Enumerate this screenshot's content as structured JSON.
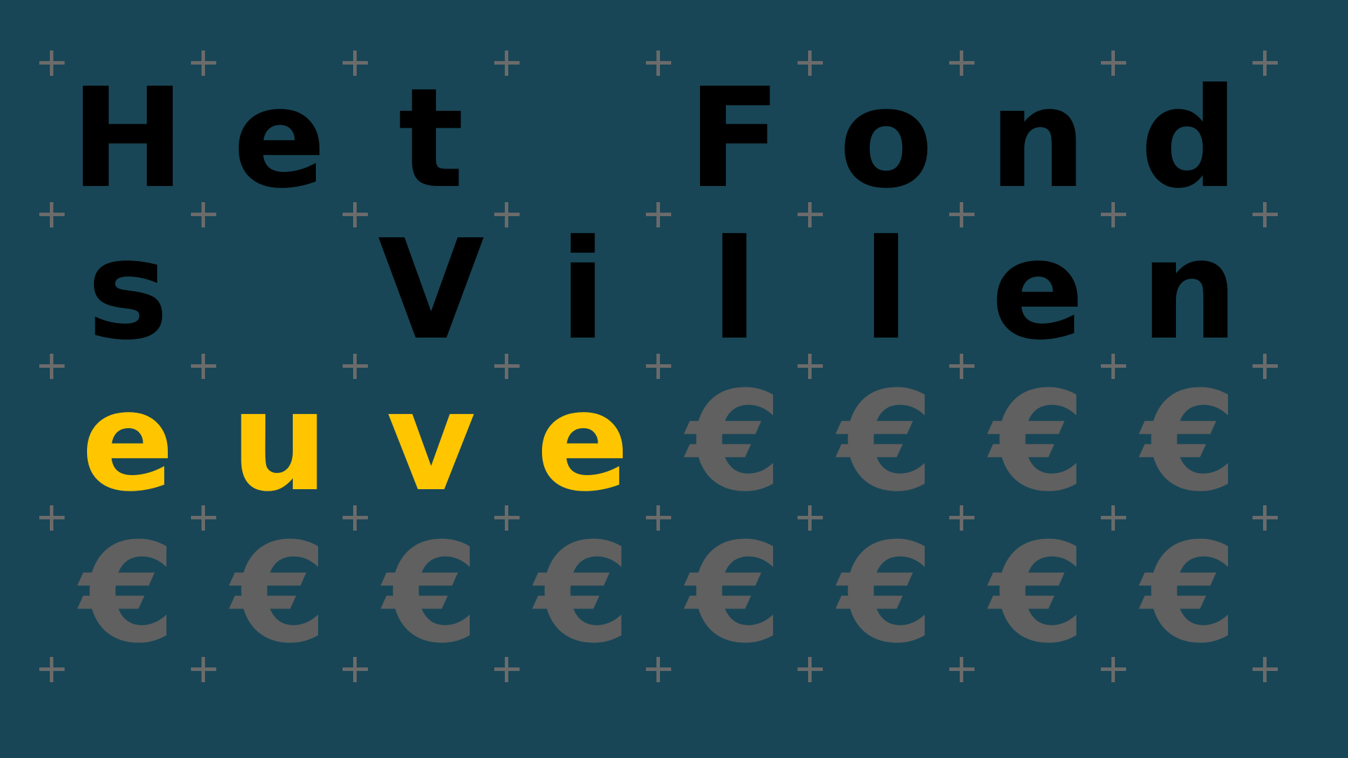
{
  "colors": {
    "background": "#184656",
    "letter": "#000000",
    "highlight": "#ffc600",
    "euro": "#606060",
    "plus": "#6b6b6b"
  },
  "grid": [
    [
      {
        "char": "H",
        "tone": "letter"
      },
      {
        "char": "e",
        "tone": "letter"
      },
      {
        "char": "t",
        "tone": "letter"
      },
      {
        "char": "",
        "tone": "letter"
      },
      {
        "char": "F",
        "tone": "letter"
      },
      {
        "char": "o",
        "tone": "letter"
      },
      {
        "char": "n",
        "tone": "letter"
      },
      {
        "char": "d",
        "tone": "letter"
      }
    ],
    [
      {
        "char": "s",
        "tone": "letter"
      },
      {
        "char": "",
        "tone": "letter"
      },
      {
        "char": "V",
        "tone": "letter"
      },
      {
        "char": "i",
        "tone": "letter"
      },
      {
        "char": "l",
        "tone": "letter"
      },
      {
        "char": "l",
        "tone": "letter"
      },
      {
        "char": "e",
        "tone": "letter"
      },
      {
        "char": "n",
        "tone": "letter"
      }
    ],
    [
      {
        "char": "e",
        "tone": "highlight"
      },
      {
        "char": "u",
        "tone": "highlight"
      },
      {
        "char": "v",
        "tone": "highlight"
      },
      {
        "char": "e",
        "tone": "highlight"
      },
      {
        "char": "€",
        "tone": "euro"
      },
      {
        "char": "€",
        "tone": "euro"
      },
      {
        "char": "€",
        "tone": "euro"
      },
      {
        "char": "€",
        "tone": "euro"
      }
    ],
    [
      {
        "char": "€",
        "tone": "euro"
      },
      {
        "char": "€",
        "tone": "euro"
      },
      {
        "char": "€",
        "tone": "euro"
      },
      {
        "char": "€",
        "tone": "euro"
      },
      {
        "char": "€",
        "tone": "euro"
      },
      {
        "char": "€",
        "tone": "euro"
      },
      {
        "char": "€",
        "tone": "euro"
      },
      {
        "char": "€",
        "tone": "euro"
      }
    ]
  ],
  "plus_marker": {
    "icon": "plus-icon",
    "rows": 5,
    "cols": 9
  }
}
